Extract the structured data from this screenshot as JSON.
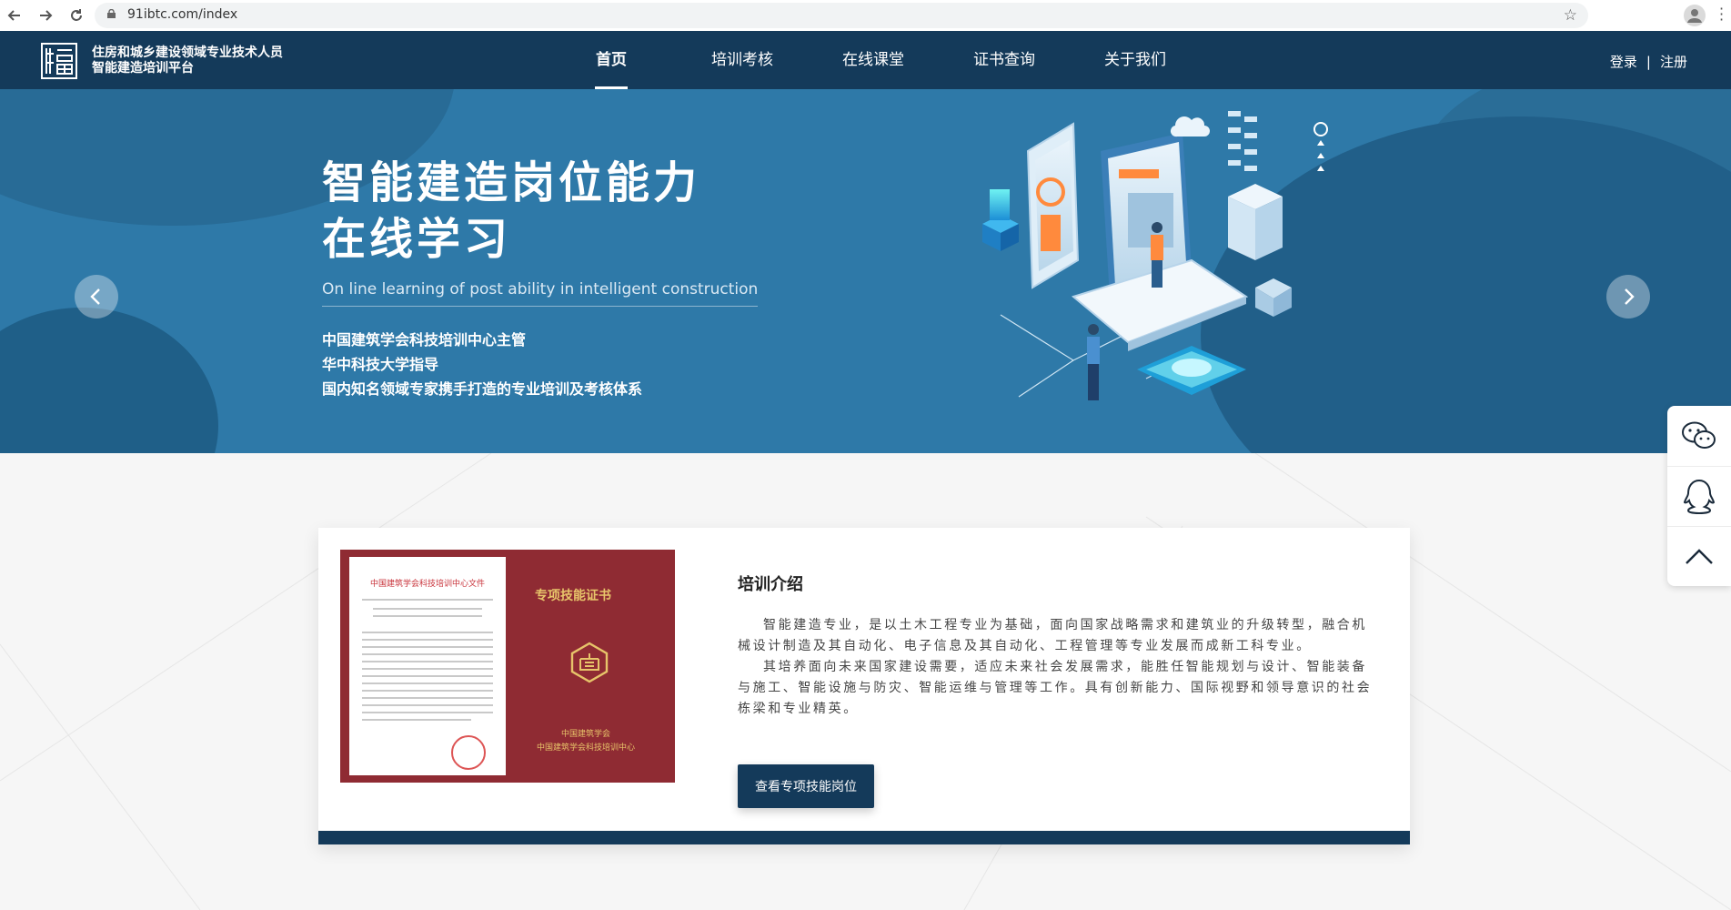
{
  "browser": {
    "url": "91ibtc.com/index",
    "back_icon": "arrow-left-icon",
    "forward_icon": "arrow-right-icon",
    "reload_icon": "reload-icon",
    "lock_icon": "lock-icon",
    "bookmark_icon": "star-icon",
    "profile_icon": "account-icon",
    "menu_icon": "kebab-icon"
  },
  "header": {
    "logo_line1": "住房和城乡建设领域专业技术人员",
    "logo_line2": "智能建造培训平台",
    "nav": [
      {
        "label": "首页",
        "active": true
      },
      {
        "label": "培训考核"
      },
      {
        "label": "在线课堂"
      },
      {
        "label": "证书查询"
      },
      {
        "label": "关于我们"
      }
    ],
    "login": "登录",
    "separator": "|",
    "register": "注册",
    "colors": {
      "bar": "#143a5a",
      "text": "#ffffff"
    }
  },
  "banner": {
    "headline_line1": "智能建造岗位能力",
    "headline_line2": "在线学习",
    "subline": "On line learning of post ability in intelligent construction",
    "bullets": [
      "中国建筑学会科技培训中心主管",
      "华中科技大学指导",
      "国内知名领域专家携手打造的专业培训及考核体系"
    ],
    "prev_icon": "chevron-left-icon",
    "next_icon": "chevron-right-icon",
    "colors": {
      "background": "#2e79a8"
    }
  },
  "side_toolbar": {
    "items": [
      "wechat-icon",
      "qq-icon",
      "back-to-top-icon"
    ]
  },
  "intro": {
    "title": "培训介绍",
    "paragraphs": [
      "智能建造专业，是以土木工程专业为基础，面向国家战略需求和建筑业的升级转型，融合机械设计制造及其自动化、电子信息及其自动化、工程管理等专业发展而成新工科专业。",
      "其培养面向未来国家建设需要，适应未来社会发展需求，能胜任智能规划与设计、智能装备与施工、智能设施与防灾、智能运维与管理等工作。具有创新能力、国际视野和领导意识的社会栋梁和专业精英。"
    ],
    "cta_label": "查看专项技能岗位",
    "certificate": {
      "doc_title": "中国建筑学会科技培训中心文件",
      "cover_title": "专项技能证书",
      "issuer_line1": "中国建筑学会",
      "issuer_line2": "中国建筑学会科技培训中心",
      "emblem_icon": "certificate-emblem-icon"
    },
    "colors": {
      "accent": "#143a5a",
      "certificate": "#8f2b33"
    }
  }
}
